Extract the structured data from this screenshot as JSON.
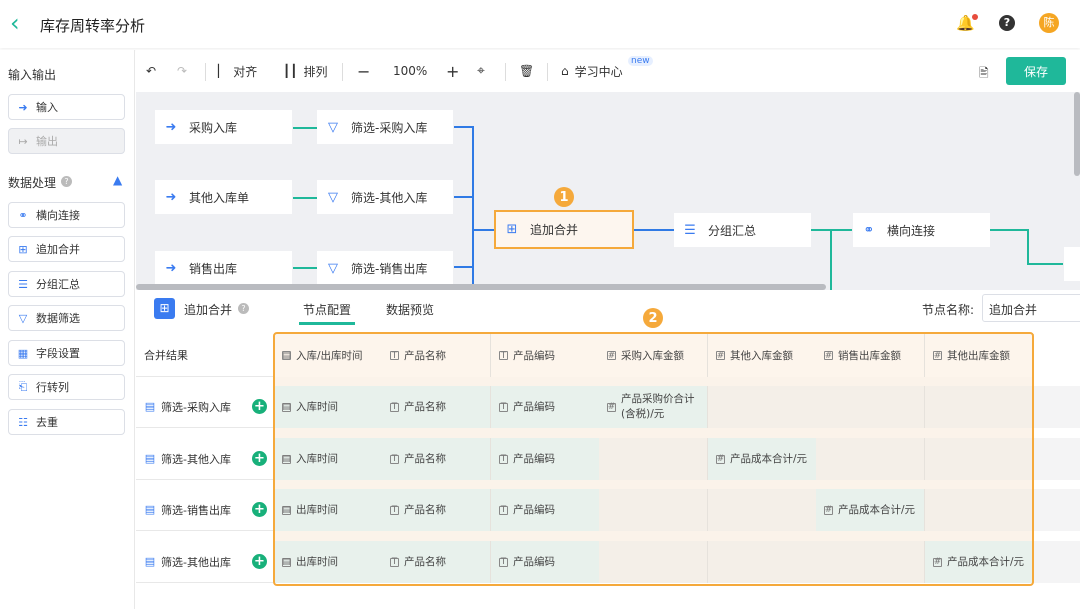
{
  "header": {
    "title": "库存周转率分析",
    "avatar": "陈",
    "icons": [
      "back-chevron-icon",
      "bell-icon",
      "help-icon"
    ]
  },
  "sidebar": {
    "section1": "输入输出",
    "io": [
      {
        "label": "输入",
        "icon": "input-arrow-icon"
      },
      {
        "label": "输出",
        "icon": "output-arrow-icon",
        "disabled": true
      }
    ],
    "section2": "数据处理",
    "items": [
      {
        "label": "横向连接",
        "icon": "join-icon"
      },
      {
        "label": "追加合并",
        "icon": "append-icon"
      },
      {
        "label": "分组汇总",
        "icon": "list-icon"
      },
      {
        "label": "数据筛选",
        "icon": "filter-icon"
      },
      {
        "label": "字段设置",
        "icon": "table-icon"
      },
      {
        "label": "行转列",
        "icon": "pivot-icon"
      },
      {
        "label": "去重",
        "icon": "dedupe-icon"
      }
    ]
  },
  "toolbar": {
    "align": "对齐",
    "arrange": "排列",
    "zoom": "100%",
    "learn": "学习中心",
    "new_badge": "new",
    "save": "保存"
  },
  "canvas": {
    "inputs": [
      "采购入库",
      "其他入库单",
      "销售出库"
    ],
    "filters": [
      "筛选-采购入库",
      "筛选-其他入库",
      "筛选-销售出库"
    ],
    "append": "追加合并",
    "group": "分组汇总",
    "join": "横向连接",
    "badge1": "1"
  },
  "panel": {
    "title": "追加合并",
    "tabs": [
      "节点配置",
      "数据预览"
    ],
    "active_tab": 0,
    "node_name_label": "节点名称:",
    "node_name_value": "追加合并",
    "badge2": "2",
    "table": {
      "corner": "合并结果",
      "columns": [
        "入库/出库时间",
        "产品名称",
        "产品编码",
        "采购入库金额",
        "其他入库金额",
        "销售出库金额",
        "其他出库金额"
      ],
      "rows": [
        {
          "source": "筛选-采购入库",
          "cells": [
            "入库时间",
            "产品名称",
            "产品编码",
            "产品采购价合计(含税)/元",
            "",
            "",
            ""
          ]
        },
        {
          "source": "筛选-其他入库",
          "cells": [
            "入库时间",
            "产品名称",
            "产品编码",
            "",
            "产品成本合计/元",
            "",
            ""
          ]
        },
        {
          "source": "筛选-销售出库",
          "cells": [
            "出库时间",
            "产品名称",
            "产品编码",
            "",
            "",
            "产品成本合计/元",
            ""
          ]
        },
        {
          "source": "筛选-其他出库",
          "cells": [
            "出库时间",
            "产品名称",
            "产品编码",
            "",
            "",
            "",
            "产品成本合计/元"
          ]
        }
      ]
    }
  },
  "colors": {
    "accent": "#1fb89a",
    "highlight": "#f5a93b",
    "link": "#2f7ae5"
  }
}
